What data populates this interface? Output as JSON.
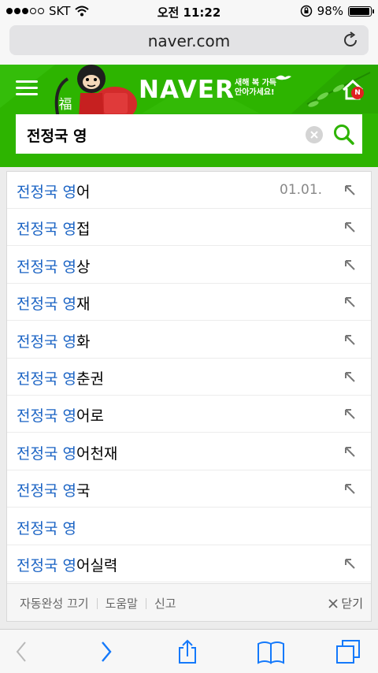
{
  "status_bar": {
    "carrier": "SKT",
    "time": "오전 11:22",
    "battery": "98%",
    "battery_level": 0.98,
    "icons": [
      "signal-dots-icon",
      "wifi-icon",
      "rotation-lock-icon",
      "battery-icon"
    ]
  },
  "browser": {
    "url": "naver.com",
    "reload_icon": "reload-icon"
  },
  "header": {
    "logo": "NAVER",
    "tagline_line1": "새해 복 가득",
    "tagline_line2": "안아가세요!",
    "monkey_char": "福",
    "badge": "N",
    "brand_color": "#2db400"
  },
  "search": {
    "query": "전정국 영",
    "icons": [
      "clear-icon",
      "search-icon"
    ]
  },
  "suggestions": [
    {
      "match": "전정국 영",
      "rest": "어",
      "date": "01.01."
    },
    {
      "match": "전정국 영",
      "rest": "접"
    },
    {
      "match": "전정국 영",
      "rest": "상"
    },
    {
      "match": "전정국 영",
      "rest": "재"
    },
    {
      "match": "전정국 영",
      "rest": "화"
    },
    {
      "match": "전정국 영",
      "rest": "춘권"
    },
    {
      "match": "전정국 영",
      "rest": "어로"
    },
    {
      "match": "전정국 영",
      "rest": "어천재"
    },
    {
      "match": "전정국 영",
      "rest": "국"
    },
    {
      "match": "전정국 영",
      "rest": "",
      "no_arrow": true
    },
    {
      "match": "전정국 영",
      "rest": "어실력"
    }
  ],
  "suggest_footer": {
    "autocomplete_off": "자동완성 끄기",
    "help": "도움말",
    "report": "신고",
    "close": "닫기"
  },
  "toolbar": {
    "icons": [
      "back-icon",
      "forward-icon",
      "share-icon",
      "bookmarks-icon",
      "tabs-icon"
    ]
  },
  "colors": {
    "highlight": "#1a63c4",
    "toolbar_active": "#1479fb",
    "toolbar_disabled": "#b8b8b8"
  }
}
